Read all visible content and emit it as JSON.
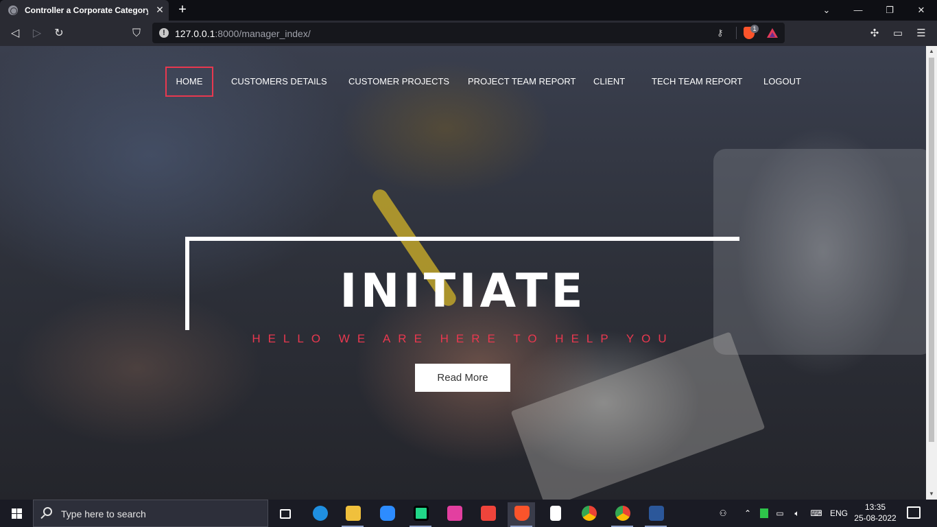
{
  "browser": {
    "tab_title": "Controller a Corporate Category F",
    "close_glyph": "✕",
    "newtab_glyph": "+",
    "url_host": "127.0.0.1",
    "url_rest": ":8000/manager_index/",
    "info_glyph": "!",
    "shields_badge": "1",
    "icons": [
      "back-icon",
      "forward-icon",
      "reload-icon",
      "bookmark-icon",
      "key-icon",
      "brave-shields-icon",
      "bat-rewards-icon",
      "extensions-icon",
      "wallet-icon",
      "menu-icon"
    ]
  },
  "nav": {
    "items": [
      "HOME",
      "CUSTOMERS DETAILS",
      "CUSTOMER PROJECTS",
      "PROJECT TEAM REPORT",
      "CLIENT",
      "TECH TEAM REPORT",
      "LOGOUT"
    ],
    "active": "HOME",
    "accent_color": "#e9384f"
  },
  "hero": {
    "title": "INITIATE",
    "subtitle": "HELLO WE ARE HERE TO HELP YOU",
    "button": "Read More"
  },
  "taskbar": {
    "search_placeholder": "Type here to search",
    "language": "ENG",
    "time": "13:35",
    "date": "25-08-2022",
    "apps": [
      "task-view-icon",
      "edge-icon",
      "file-explorer-icon",
      "zoom-icon",
      "pycharm-icon",
      "jetbrains-toolbox-icon",
      "anydesk-icon",
      "brave-icon",
      "notepad-icon",
      "chrome-icon",
      "chrome-profile-icon",
      "word-icon"
    ]
  }
}
